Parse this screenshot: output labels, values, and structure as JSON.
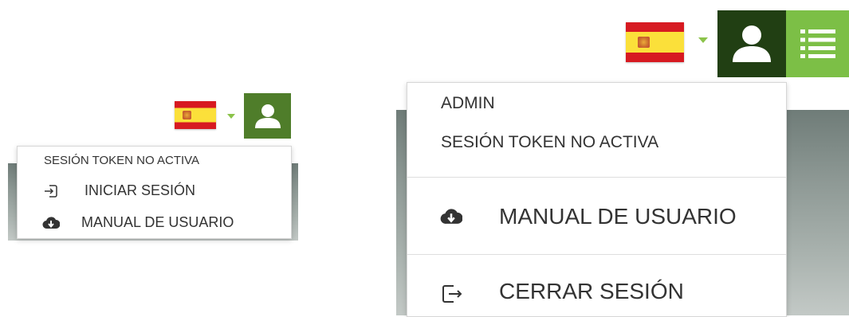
{
  "left_panel": {
    "language_flag": "spain-flag",
    "dropdown": {
      "status_label": "SESIÓN TOKEN NO ACTIVA",
      "items": [
        {
          "label": "INICIAR SESIÓN",
          "icon": "login-icon"
        },
        {
          "label": "MANUAL DE USUARIO",
          "icon": "cloud-download-icon"
        }
      ]
    }
  },
  "right_panel": {
    "language_flag": "spain-flag",
    "dropdown": {
      "user_label": "ADMIN",
      "status_label": "SESIÓN TOKEN NO ACTIVA",
      "items": [
        {
          "label": "MANUAL DE USUARIO",
          "icon": "cloud-download-icon"
        },
        {
          "label": "CERRAR SESIÓN",
          "icon": "logout-icon"
        }
      ]
    }
  },
  "colors": {
    "avatar_bg_left": "#4f7d2a",
    "avatar_bg_right": "#213f13",
    "menu_bg": "#7cbf46",
    "caret": "#8bc34a"
  }
}
